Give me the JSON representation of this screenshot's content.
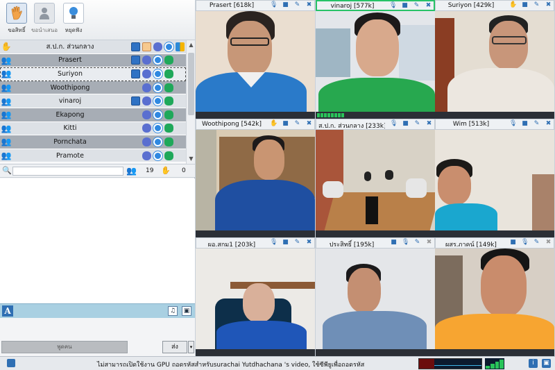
{
  "toolbar": {
    "buttons": [
      {
        "label": "ขอสิทธิ์",
        "icon": "raise-hand-icon"
      },
      {
        "label": "ขอนำเสนอ",
        "icon": "presenter-icon"
      },
      {
        "label": "หยุดฟัง",
        "icon": "bulb-icon"
      }
    ]
  },
  "users": [
    {
      "name": "ส.ป.ก. ส่วนกลาง",
      "style": "head"
    },
    {
      "name": "Prasert",
      "style": "dark"
    },
    {
      "name": "Suriyon",
      "style": "selected"
    },
    {
      "name": "Woothipong",
      "style": "dark"
    },
    {
      "name": "vinaroj",
      "style": "light"
    },
    {
      "name": "Ekapong",
      "style": "dark"
    },
    {
      "name": "Kitti",
      "style": "light"
    },
    {
      "name": "Pornchata",
      "style": "dark"
    },
    {
      "name": "Pramote",
      "style": "light"
    }
  ],
  "search": {
    "placeholder": "",
    "user_count": "19",
    "hand_count": "0"
  },
  "chat": {
    "input_placeholder": "พูดคน",
    "send_label": "ส่ง"
  },
  "tiles": [
    {
      "name": "Prasert [618k]"
    },
    {
      "name": "vinaroj [577k]"
    },
    {
      "name": "Suriyon [429k]"
    },
    {
      "name": "Woothipong [542k]"
    },
    {
      "name": "ส.ป.ก. ส่วนกลาง [233k]"
    },
    {
      "name": "Wim [513k]"
    },
    {
      "name": "ผอ.สกม1 [203k]"
    },
    {
      "name": "ประสิทธิ์ [195k]"
    },
    {
      "name": "ผสร.ภาคน์ [149k]"
    }
  ],
  "status": {
    "message": "ไม่สามารถเปิดใช้งาน GPU ถอดรหัสสำหรับsurachai Yutdhachana  's video, ใช้ซีพียูเพื่อถอดรหัส"
  },
  "colors": {
    "accent": "#2f6fb3",
    "active_border": "#27c267",
    "row_dark": "#a7adb5",
    "row_light": "#dde1e6",
    "chat_toolbar": "#a9d0e2"
  }
}
